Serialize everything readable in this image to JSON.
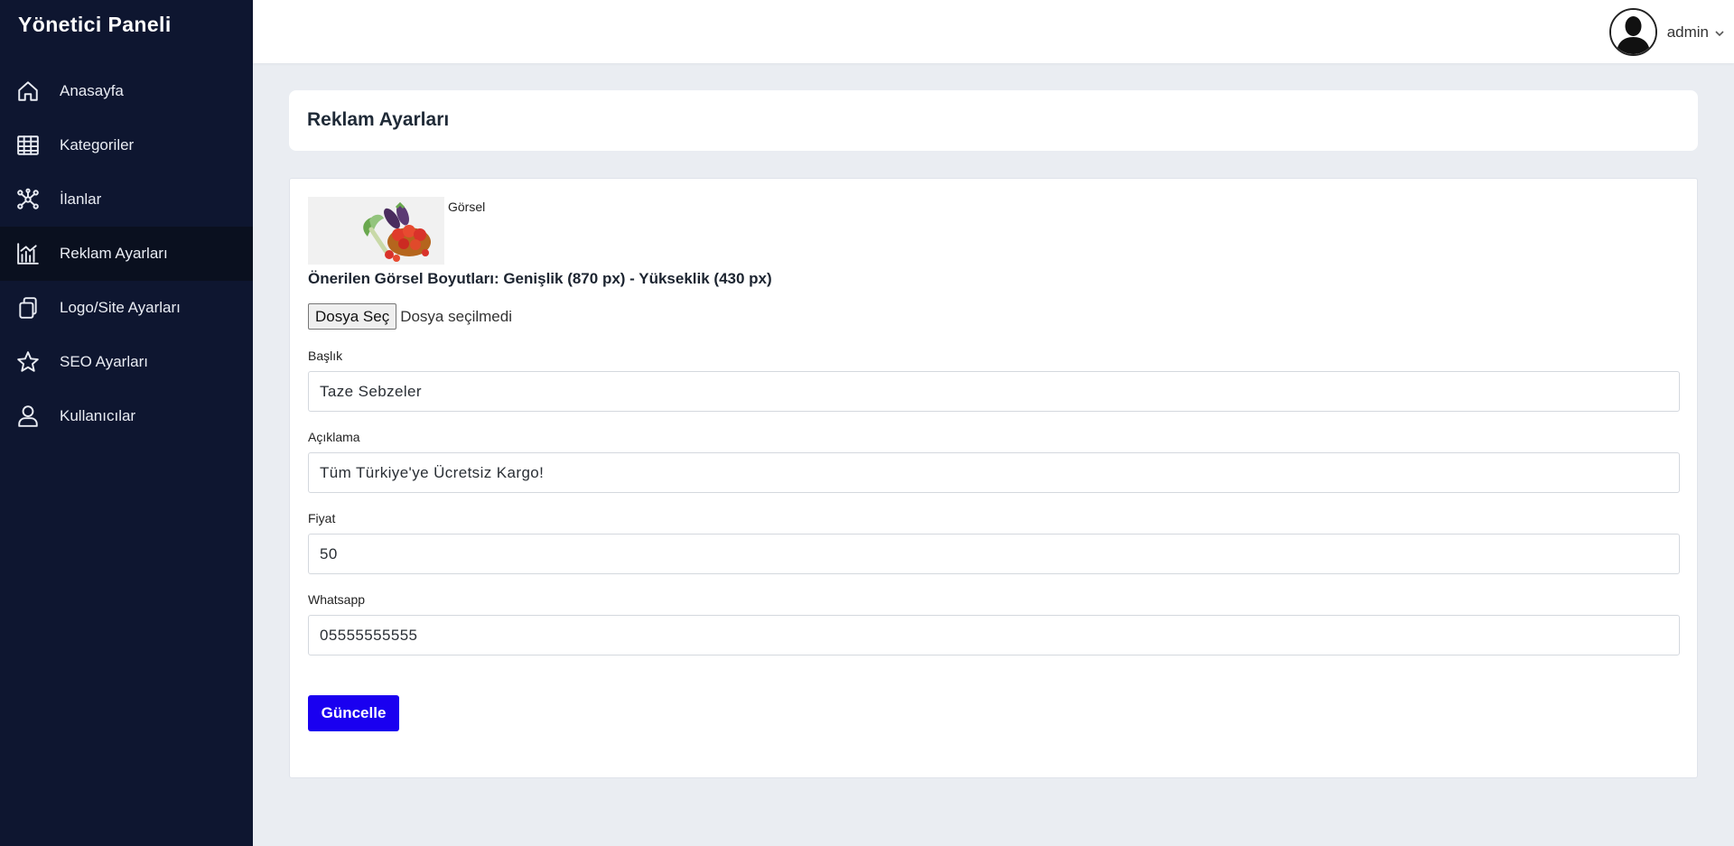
{
  "sidebar": {
    "brand": "Yönetici Paneli",
    "items": [
      {
        "label": "Anasayfa",
        "icon": "home-icon"
      },
      {
        "label": "Kategoriler",
        "icon": "grid-icon"
      },
      {
        "label": "İlanlar",
        "icon": "network-icon"
      },
      {
        "label": "Reklam Ayarları",
        "icon": "chart-icon",
        "active": true
      },
      {
        "label": "Logo/Site Ayarları",
        "icon": "copy-icon"
      },
      {
        "label": "SEO Ayarları",
        "icon": "star-icon"
      },
      {
        "label": "Kullanıcılar",
        "icon": "user-icon"
      }
    ]
  },
  "topbar": {
    "user_name": "admin"
  },
  "page": {
    "title": "Reklam Ayarları"
  },
  "form": {
    "image_caption": "Görsel",
    "size_hint": "Önerilen Görsel Boyutları: Genişlik (870 px) - Yükseklik (430 px)",
    "file_button": "Dosya Seç",
    "file_status": "Dosya seçilmedi",
    "fields": [
      {
        "label": "Başlık",
        "value": "Taze Sebzeler"
      },
      {
        "label": "Açıklama",
        "value": "Tüm Türkiye'ye Ücretsiz Kargo!"
      },
      {
        "label": "Fiyat",
        "value": "50"
      },
      {
        "label": "Whatsapp",
        "value": "05555555555"
      }
    ],
    "submit_label": "Güncelle"
  },
  "colors": {
    "sidebar_bg": "#0e1630",
    "sidebar_active_bg": "#0a101f",
    "page_bg": "#eaedf2",
    "submit_bg": "#1a00f0"
  }
}
